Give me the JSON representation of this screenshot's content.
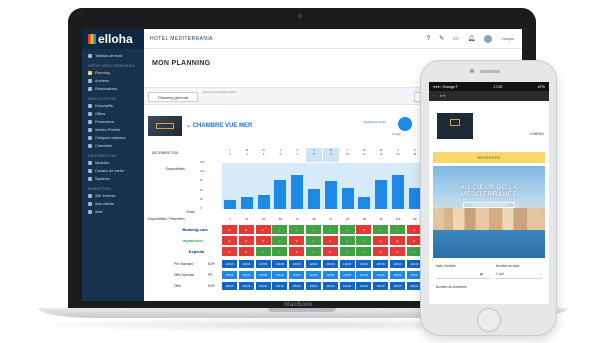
{
  "laptop": {
    "brand_label": "MacBook",
    "sidebar": {
      "logo": "elloha",
      "top_item": "Tableau de bord",
      "sections": [
        {
          "title": "Hôtel Méditerrannia",
          "items": [
            {
              "label": "Planning",
              "active": true
            },
            {
              "label": "Arrivées",
              "active": false
            },
            {
              "label": "Réservations",
              "active": false
            }
          ]
        },
        {
          "title": "Mon activité",
          "items": [
            {
              "label": "Descriptifs",
              "active": false
            },
            {
              "label": "Offres",
              "active": false
            },
            {
              "label": "Promotions",
              "active": false
            },
            {
              "label": "Ventes Privées",
              "active": false
            },
            {
              "label": "Chèques cadeaux",
              "active": false
            },
            {
              "label": "Calendrier",
              "active": false
            }
          ]
        },
        {
          "title": "Distribution",
          "items": [
            {
              "label": "Modules",
              "active": false
            },
            {
              "label": "Canaux de vente",
              "active": false
            },
            {
              "label": "Système",
              "active": false
            }
          ]
        },
        {
          "title": "Marketing",
          "items": [
            {
              "label": "Site Internet",
              "active": false
            },
            {
              "label": "Avis clients",
              "active": false
            },
            {
              "label": "Aide",
              "active": false
            }
          ]
        }
      ]
    },
    "topbar": {
      "hotel_name": "HOTEL MEDITERRANIA",
      "icons": [
        "help-icon",
        "edit-icon",
        "monitor-icon",
        "bell-icon"
      ],
      "user_label": "Compte"
    },
    "page_title": "MON PLANNING",
    "tabs": {
      "main": "Planning général",
      "description": "Gérer les prix et disponibilités",
      "today": "Aujourd'hui",
      "prev": "Préc"
    },
    "room": {
      "name": "CHAMBRE VUE MER",
      "modification_link": "Modification rapide",
      "mode_label": "Gestion"
    },
    "planning": {
      "month_label": "DÉCEMBRE 2018",
      "days": [
        {
          "dow": "L",
          "num": "3"
        },
        {
          "dow": "M",
          "num": "4"
        },
        {
          "dow": "M",
          "num": "5"
        },
        {
          "dow": "J",
          "num": "6"
        },
        {
          "dow": "V",
          "num": "7"
        },
        {
          "dow": "S",
          "num": "8"
        },
        {
          "dow": "D",
          "num": "9"
        },
        {
          "dow": "L",
          "num": "10"
        },
        {
          "dow": "M",
          "num": "11"
        },
        {
          "dow": "M",
          "num": "12"
        },
        {
          "dow": "J",
          "num": "13"
        },
        {
          "dow": "V",
          "num": "14"
        },
        {
          "dow": "S",
          "num": "15"
        },
        {
          "dow": "D",
          "num": "16"
        },
        {
          "dow": "L",
          "num": "17"
        }
      ],
      "highlight_days": [
        5,
        6
      ],
      "availability_label": "Disponibilités",
      "y_ticks": [
        "150",
        "120",
        "90",
        "60",
        "30",
        "0"
      ],
      "availability": [
        30,
        40,
        45,
        95,
        110,
        65,
        90,
        70,
        40,
        95,
        110,
        70,
        85,
        60,
        40
      ],
      "vendu_label": "Vendu",
      "vendu": [
        "",
        "",
        "",
        "",
        "",
        "",
        "",
        "",
        "",
        "",
        "",
        "",
        "",
        "",
        ""
      ],
      "dispo_row_label": "Disponibilités / Réservées",
      "dispo_row": [
        "5",
        "31",
        "29",
        "80",
        "41",
        "28",
        "47",
        "26",
        "38",
        "59",
        "118",
        "80",
        "59",
        "44",
        "31"
      ],
      "channels": [
        {
          "name": "Booking.com",
          "color": "#003580",
          "cells": [
            "r",
            "r",
            "r",
            "g",
            "g",
            "g",
            "g",
            "g",
            "r",
            "g",
            "g",
            "r",
            "r",
            "g",
            "g"
          ]
        },
        {
          "name": "tripadvisor",
          "color": "#34a853",
          "cells": [
            "r",
            "r",
            "r",
            "g",
            "r",
            "g",
            "r",
            "g",
            "g",
            "r",
            "r",
            "r",
            "r",
            "g",
            "g"
          ]
        },
        {
          "name": "Expedia",
          "color": "#1f3b70",
          "cells": [
            "r",
            "r",
            "g",
            "g",
            "r",
            "g",
            "r",
            "g",
            "g",
            "r",
            "r",
            "g",
            "g",
            "r",
            "g"
          ]
        }
      ],
      "price_rows": [
        {
          "label": "Prix Standard",
          "code": "EUR",
          "values": [
            "120,00",
            "120,00",
            "120,00",
            "120,00",
            "120,00",
            "120,00",
            "120,00",
            "120,00",
            "120,00",
            "120,00",
            "120,00",
            "120,00",
            "120,00",
            "120,00",
            "120,00"
          ]
        },
        {
          "label": "Offre Spéciale",
          "code": "PR",
          "values": [
            "110,00",
            "110,00",
            "110,00",
            "110,00",
            "110,00",
            "110,00",
            "110,00",
            "110,00",
            "110,00",
            "110,00",
            "110,00",
            "110,00",
            "110,00",
            "110,00",
            "110,00"
          ]
        },
        {
          "label": "Offre",
          "code": "EUR",
          "values": [
            "100,00",
            "100,00",
            "100,00",
            "100,00",
            "100,00",
            "100,00",
            "100,00",
            "100,00",
            "100,00",
            "100,00",
            "100,00",
            "100,00",
            "100,00",
            "100,00",
            "100,00"
          ]
        }
      ]
    }
  },
  "phone": {
    "status_carrier": "●●●○ Orange F",
    "status_time": "17:52",
    "status_battery": "67%",
    "url_text": "fr ▾",
    "menu_label": "≡ MENU",
    "gold_banner": "RÉSERVER",
    "hero_title_line1": "AU CŒUR DE LA",
    "hero_title_line2": "MÉDITERRANÉE",
    "hero_button": "TROUVER LES PLUS BELLES",
    "form": {
      "arrival_label": "Date d'arrivée",
      "nights_label": "Nombre de nuits",
      "nights_value": "1 nuit",
      "rooms_label": "Nombre de chambres"
    }
  }
}
